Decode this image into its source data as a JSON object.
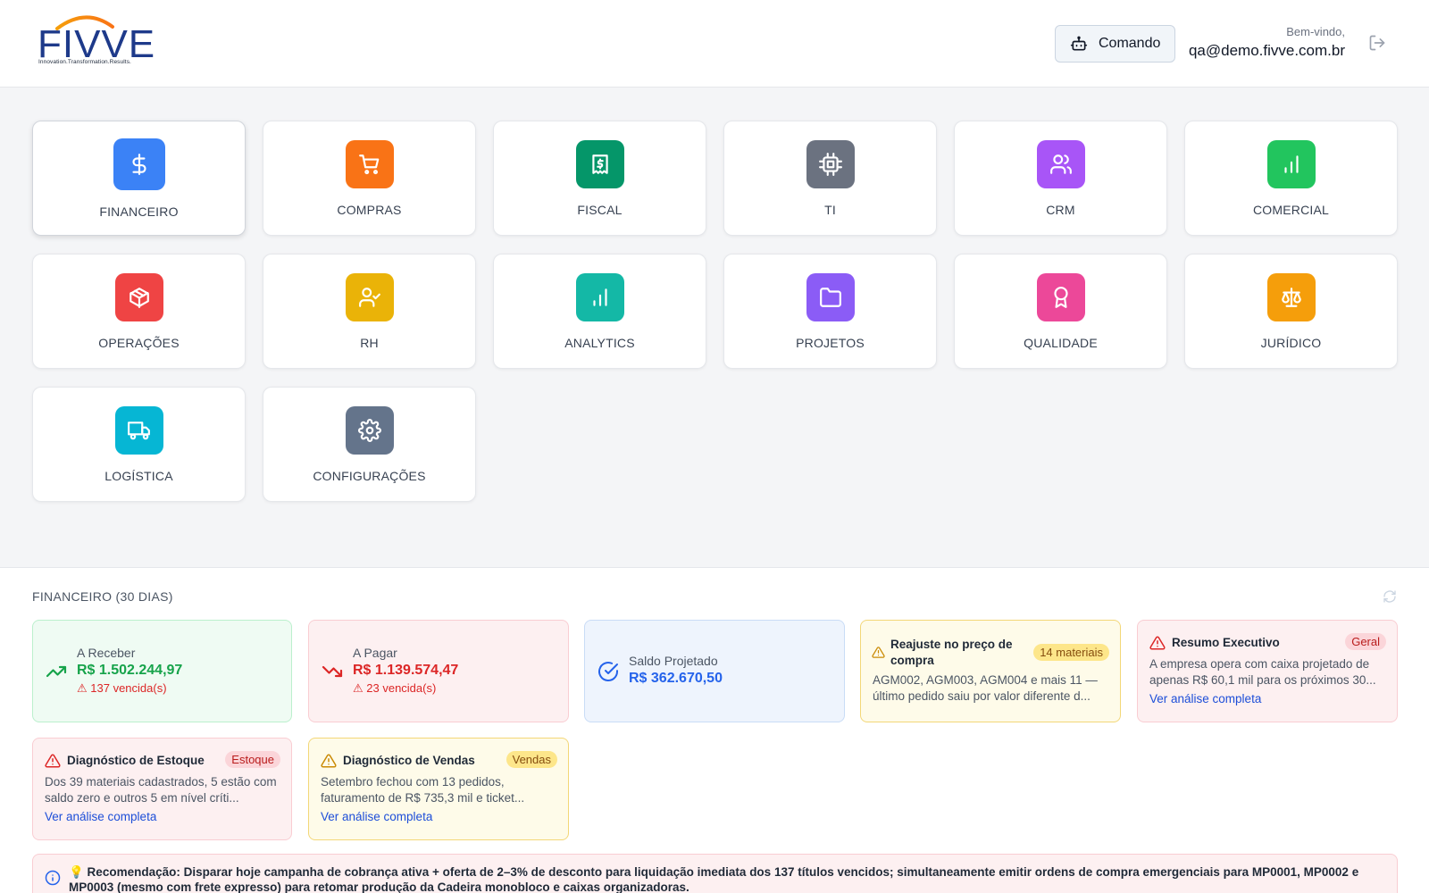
{
  "header": {
    "logo_text": "FIVVE",
    "logo_tagline": "Innovation.Transformation.Results.",
    "command_label": "Comando",
    "welcome_label": "Bem-vindo,",
    "user_email": "qa@demo.fivve.com.br"
  },
  "modules": [
    {
      "label": "FINANCEIRO",
      "color": "#3b82f6",
      "icon": "dollar-icon"
    },
    {
      "label": "COMPRAS",
      "color": "#f97316",
      "icon": "cart-icon"
    },
    {
      "label": "FISCAL",
      "color": "#059669",
      "icon": "receipt-icon"
    },
    {
      "label": "TI",
      "color": "#6b7280",
      "icon": "cpu-icon"
    },
    {
      "label": "CRM",
      "color": "#a855f7",
      "icon": "users-icon"
    },
    {
      "label": "COMERCIAL",
      "color": "#22c55e",
      "icon": "bar-chart-icon"
    },
    {
      "label": "OPERAÇÕES",
      "color": "#ef4444",
      "icon": "package-icon"
    },
    {
      "label": "RH",
      "color": "#eab308",
      "icon": "user-check-icon"
    },
    {
      "label": "ANALYTICS",
      "color": "#14b8a6",
      "icon": "bar-chart-icon"
    },
    {
      "label": "PROJETOS",
      "color": "#8b5cf6",
      "icon": "folder-icon"
    },
    {
      "label": "QUALIDADE",
      "color": "#ec4899",
      "icon": "award-icon"
    },
    {
      "label": "JURÍDICO",
      "color": "#f59e0b",
      "icon": "scale-icon"
    },
    {
      "label": "LOGÍSTICA",
      "color": "#06b6d4",
      "icon": "truck-icon"
    },
    {
      "label": "CONFIGURAÇÕES",
      "color": "#64748b",
      "icon": "settings-icon"
    }
  ],
  "finance": {
    "title": "FINANCEIRO (30 DIAS)",
    "receivable": {
      "label": "A Receber",
      "value": "R$ 1.502.244,97",
      "overdue": "⚠ 137 vencida(s)"
    },
    "payable": {
      "label": "A Pagar",
      "value": "R$ 1.139.574,47",
      "overdue": "⚠ 23 vencida(s)"
    },
    "projected": {
      "label": "Saldo Projetado",
      "value": "R$ 362.670,50"
    },
    "price_adjust": {
      "title": "Reajuste no preço de compra",
      "badge": "14 materiais",
      "body": "AGM002, AGM003, AGM004 e mais 11 — último pedido saiu por valor diferente d..."
    },
    "exec_summary": {
      "title": "Resumo Executivo",
      "badge": "Geral",
      "body": "A empresa opera com caixa projetado de apenas R$ 60,1 mil para os próximos 30...",
      "link": "Ver análise completa"
    },
    "stock": {
      "title": "Diagnóstico de Estoque",
      "badge": "Estoque",
      "body": "Dos 39 materiais cadastrados, 5 estão com saldo zero e outros 5 em nível críti...",
      "link": "Ver análise completa"
    },
    "sales": {
      "title": "Diagnóstico de Vendas",
      "badge": "Vendas",
      "body": "Setembro fechou com 13 pedidos, faturamento de R$ 735,3 mil e ticket...",
      "link": "Ver análise completa"
    },
    "recommendation": "💡 Recomendação: Disparar hoje campanha de cobrança ativa + oferta de 2–3% de desconto para liquidação imediata dos 137 títulos vencidos; simultaneamente emitir ordens de compra emergenciais para MP0001, MP0002 e MP0003 (mesmo com frete expresso) para retomar produção da Cadeira monobloco e caixas organizadoras."
  }
}
